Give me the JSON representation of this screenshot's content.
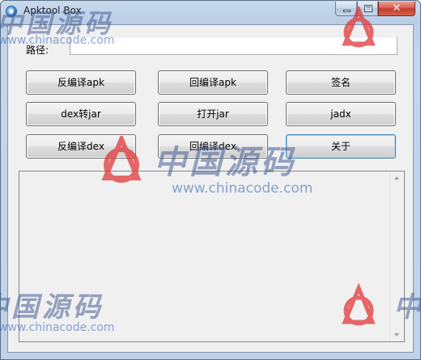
{
  "window": {
    "title": "Apktool Box",
    "controls": {
      "minimize": "",
      "maximize": "",
      "close": "✕"
    }
  },
  "path": {
    "label": "路径:",
    "value": ""
  },
  "buttons": [
    {
      "id": "decompile-apk",
      "label": "反编译apk"
    },
    {
      "id": "recompile-apk",
      "label": "回编译apk"
    },
    {
      "id": "sign",
      "label": "签名"
    },
    {
      "id": "dex2jar",
      "label": "dex转jar"
    },
    {
      "id": "open-jar",
      "label": "打开jar"
    },
    {
      "id": "jadx",
      "label": "jadx"
    },
    {
      "id": "decompile-dex",
      "label": "反编译dex"
    },
    {
      "id": "recompile-dex",
      "label": "回编译dex"
    },
    {
      "id": "about",
      "label": "关于"
    }
  ],
  "log": {
    "text": ""
  },
  "watermark": {
    "name": "中国源码",
    "url": "www.chinacode.com",
    "logo_color": "#e03838"
  }
}
